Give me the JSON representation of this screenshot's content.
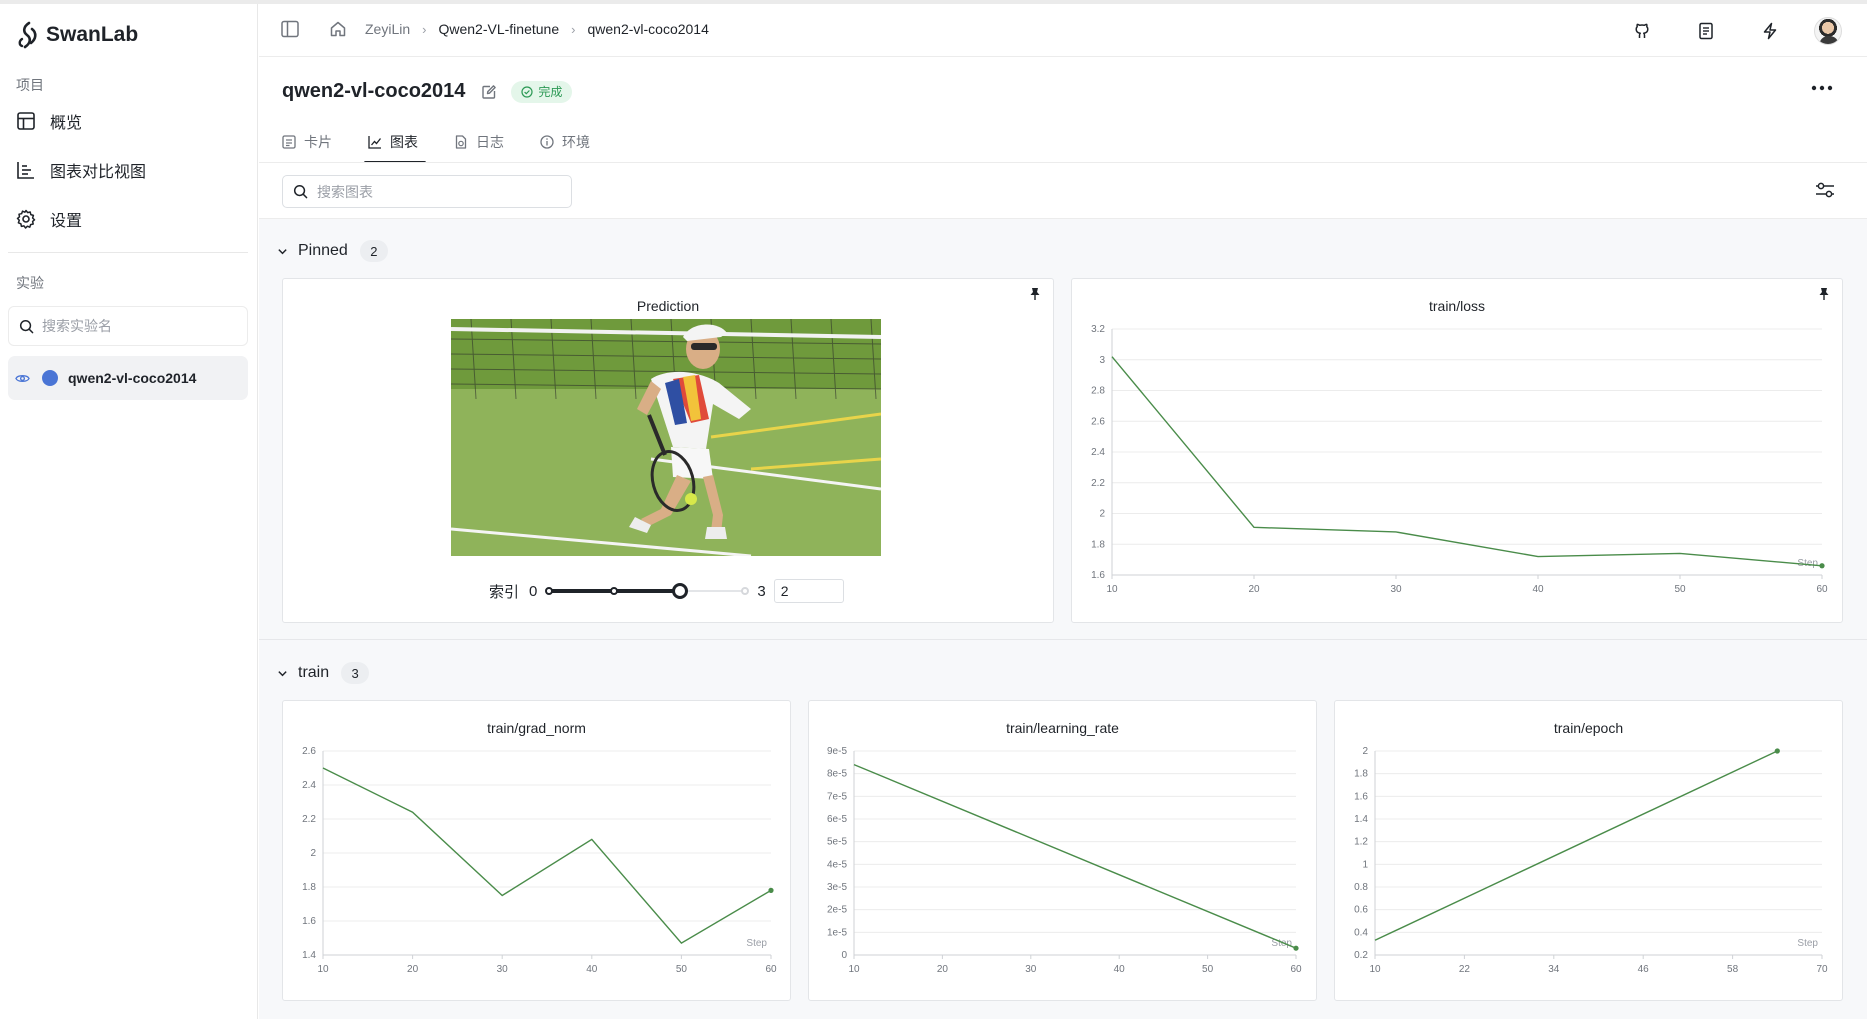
{
  "app": {
    "name": "SwanLab"
  },
  "sidebar": {
    "project_section": "项目",
    "nav": [
      {
        "label": "概览",
        "icon": "table-icon"
      },
      {
        "label": "图表对比视图",
        "icon": "bar-chart-icon"
      },
      {
        "label": "设置",
        "icon": "gear-icon"
      }
    ],
    "experiment_section": "实验",
    "experiment_search_placeholder": "搜索实验名",
    "experiments": [
      {
        "name": "qwen2-vl-coco2014",
        "color": "#4a75d5"
      }
    ]
  },
  "breadcrumb": {
    "user": "ZeyiLin",
    "project": "Qwen2-VL-finetune",
    "run": "qwen2-vl-coco2014"
  },
  "run": {
    "title": "qwen2-vl-coco2014",
    "status": "完成"
  },
  "tabs": [
    {
      "label": "卡片",
      "icon": "card-icon",
      "active": false
    },
    {
      "label": "图表",
      "icon": "line-chart-icon",
      "active": true
    },
    {
      "label": "日志",
      "icon": "log-icon",
      "active": false
    },
    {
      "label": "环境",
      "icon": "info-icon",
      "active": false
    }
  ],
  "toolbar": {
    "search_placeholder": "搜索图表"
  },
  "groups": {
    "pinned": {
      "name": "Pinned",
      "count": "2"
    },
    "train": {
      "name": "train",
      "count": "3"
    }
  },
  "prediction": {
    "title": "Prediction",
    "index_label": "索引",
    "min": "0",
    "max": "3",
    "value": "2",
    "fraction": 0.667
  },
  "chart_data": [
    {
      "id": "loss",
      "type": "line",
      "title": "train/loss",
      "x": [
        10,
        20,
        30,
        40,
        50,
        60
      ],
      "series": [
        {
          "values": [
            3.02,
            1.91,
            1.88,
            1.72,
            1.74,
            1.66
          ]
        }
      ],
      "xticks": [
        "10",
        "20",
        "30",
        "40",
        "50",
        "60"
      ],
      "yticks": [
        "1.6",
        "1.8",
        "2",
        "2.2",
        "2.4",
        "2.6",
        "2.8",
        "3",
        "3.2"
      ],
      "xlim": [
        10,
        60
      ],
      "ylim": [
        1.6,
        3.2
      ],
      "xlabel": "Step",
      "grid": true,
      "color": "#4a8c4a"
    },
    {
      "id": "grad",
      "type": "line",
      "title": "train/grad_norm",
      "x": [
        10,
        20,
        30,
        40,
        50,
        60
      ],
      "series": [
        {
          "values": [
            2.5,
            2.24,
            1.75,
            2.08,
            1.47,
            1.78
          ]
        }
      ],
      "xticks": [
        "10",
        "20",
        "30",
        "40",
        "50",
        "60"
      ],
      "yticks": [
        "1.4",
        "1.6",
        "1.8",
        "2",
        "2.2",
        "2.4",
        "2.6"
      ],
      "xlim": [
        10,
        60
      ],
      "ylim": [
        1.4,
        2.6
      ],
      "xlabel": "Step",
      "grid": true,
      "color": "#4a8c4a"
    },
    {
      "id": "lr",
      "type": "line",
      "title": "train/learning_rate",
      "x": [
        10,
        60
      ],
      "series": [
        {
          "values": [
            8.4e-05,
            3e-06
          ]
        }
      ],
      "xticks": [
        "10",
        "20",
        "30",
        "40",
        "50",
        "60"
      ],
      "yticks": [
        "0",
        "1e-5",
        "2e-5",
        "3e-5",
        "4e-5",
        "5e-5",
        "6e-5",
        "7e-5",
        "8e-5",
        "9e-5"
      ],
      "xlim": [
        10,
        60
      ],
      "ylim": [
        0,
        9e-05
      ],
      "xlabel": "Step",
      "grid": true,
      "color": "#4a8c4a"
    },
    {
      "id": "epoch",
      "type": "line",
      "title": "train/epoch",
      "x": [
        10,
        64
      ],
      "series": [
        {
          "values": [
            0.33,
            2
          ]
        }
      ],
      "xticks": [
        "10",
        "22",
        "34",
        "46",
        "58",
        "70"
      ],
      "yticks": [
        "0.2",
        "0.4",
        "0.6",
        "0.8",
        "1",
        "1.2",
        "1.4",
        "1.6",
        "1.8",
        "2"
      ],
      "xlim": [
        10,
        70
      ],
      "ylim": [
        0.2,
        2
      ],
      "xlabel": "Step",
      "grid": true,
      "color": "#4a8c4a"
    }
  ]
}
